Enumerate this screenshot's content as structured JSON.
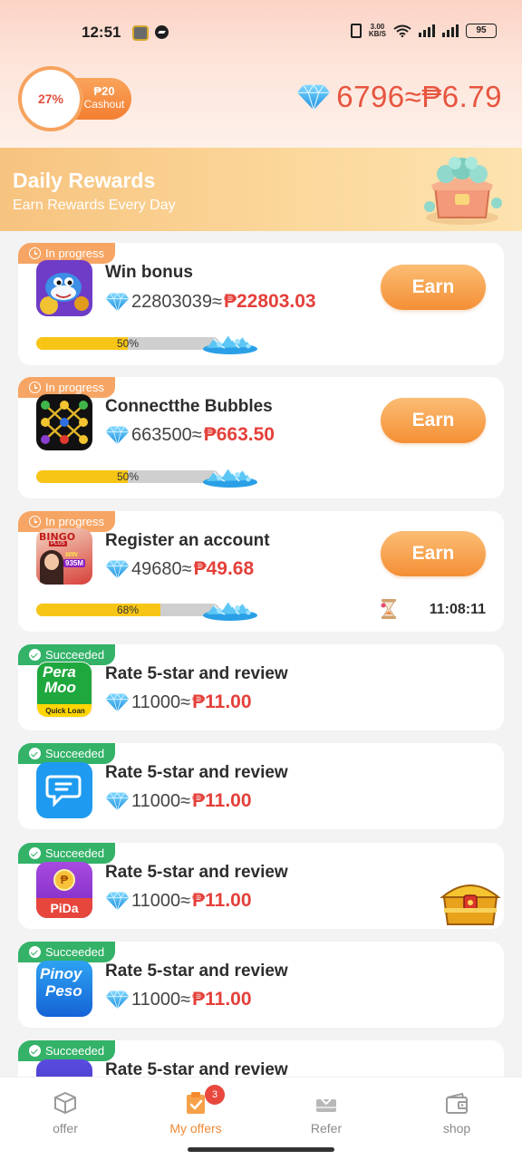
{
  "status_bar": {
    "time": "12:51",
    "speed_value": "3.00",
    "speed_unit": "KB/S",
    "battery": "95"
  },
  "header": {
    "progress_percent": "27%",
    "cashout_amount": "₱20",
    "cashout_label": "Cashout",
    "balance": "6796≈₱6.79"
  },
  "banner": {
    "title": "Daily Rewards",
    "subtitle": "Earn Rewards Every Day"
  },
  "offers": [
    {
      "status": "In progress",
      "title": "Win bonus",
      "gems": "22803039≈",
      "peso": "₱22803.03",
      "button": "Earn",
      "progress": 0.5,
      "progress_label": "50%"
    },
    {
      "status": "In progress",
      "title": "Connectthe Bubbles",
      "gems": "663500≈",
      "peso": "₱663.50",
      "button": "Earn",
      "progress": 0.5,
      "progress_label": "50%"
    },
    {
      "status": "In progress",
      "title": "Register an account",
      "gems": "49680≈",
      "peso": "₱49.68",
      "button": "Earn",
      "progress": 0.68,
      "progress_label": "68%",
      "timer": "11:08:11"
    },
    {
      "status": "Succeeded",
      "title": "Rate 5-star and review",
      "gems": "11000≈",
      "peso": "₱11.00"
    },
    {
      "status": "Succeeded",
      "title": "Rate 5-star and review",
      "gems": "11000≈",
      "peso": "₱11.00"
    },
    {
      "status": "Succeeded",
      "title": "Rate 5-star and review",
      "gems": "11000≈",
      "peso": "₱11.00"
    },
    {
      "status": "Succeeded",
      "title": "Rate 5-star and review",
      "gems": "11000≈",
      "peso": "₱11.00"
    },
    {
      "status": "Succeeded",
      "title": "Rate 5-star and review"
    }
  ],
  "app_icons": {
    "bingo_top": "BINGO",
    "bingo_sub": "PLUS",
    "bingo_win": "WIN",
    "bingo_amt": "935M",
    "peramoo_line1": "Pera",
    "peramoo_line2": "Moo",
    "peramoo_line3": "Quick Loan",
    "pida": "PiDa",
    "pinoy_line1": "Pinoy",
    "pinoy_line2": "Peso"
  },
  "bottom_nav": {
    "items": [
      {
        "label": "offer",
        "icon": "cube-icon"
      },
      {
        "label": "My offers",
        "icon": "clipboard-check-icon",
        "active": true,
        "badge": "3"
      },
      {
        "label": "Refer",
        "icon": "download-tray-icon"
      },
      {
        "label": "shop",
        "icon": "wallet-icon"
      }
    ]
  },
  "colors": {
    "accent": "#f48f35",
    "price_red": "#e4403a",
    "success": "#33b268",
    "progress_tag": "#f6a564",
    "bar_fill": "#f7c516"
  }
}
